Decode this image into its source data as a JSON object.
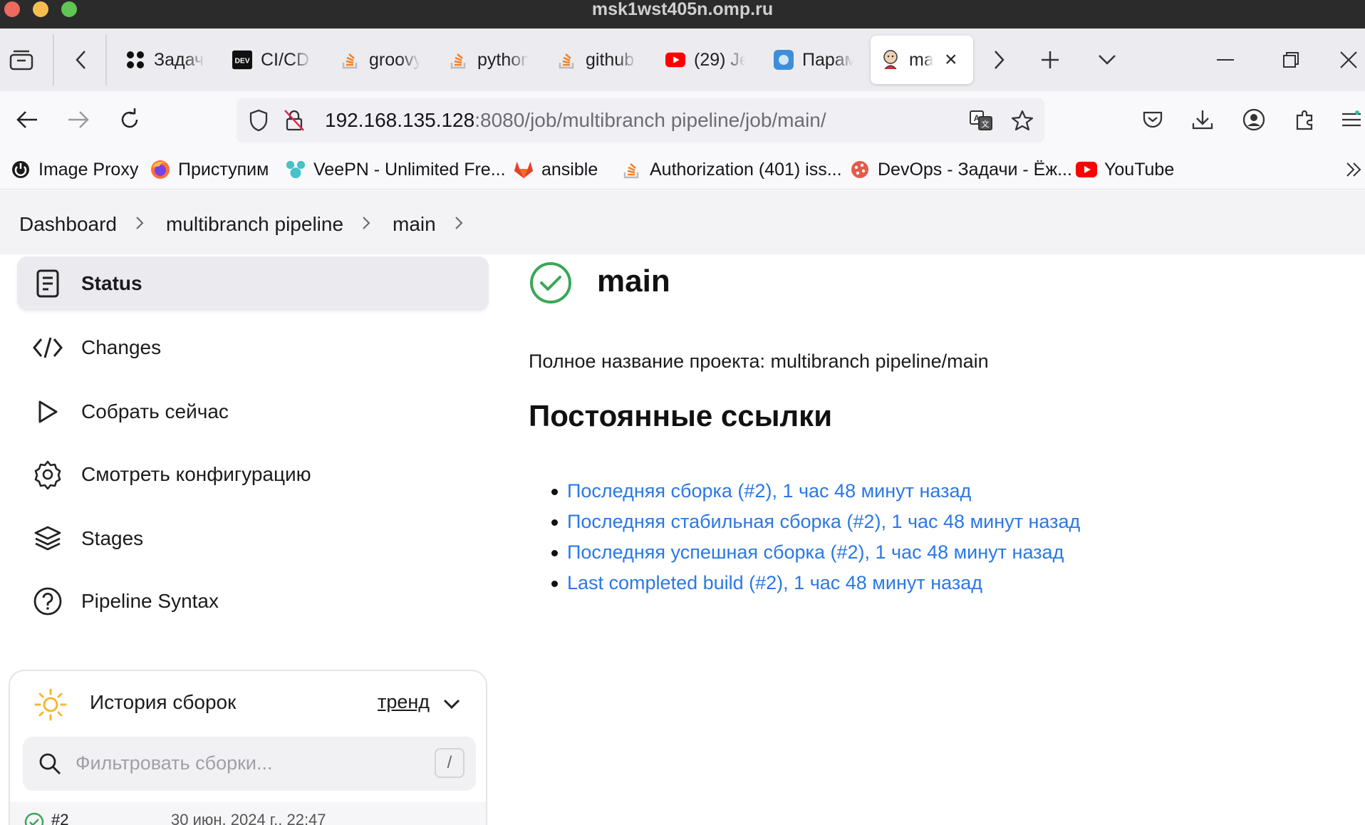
{
  "window": {
    "title": "msk1wst405n.omp.ru"
  },
  "tabs": [
    {
      "label": "Задачи",
      "icon": "puzzle-icon"
    },
    {
      "label": "CI/CD",
      "icon": "dev-icon"
    },
    {
      "label": "groovy",
      "icon": "stackoverflow-icon"
    },
    {
      "label": "python",
      "icon": "stackoverflow-icon"
    },
    {
      "label": "github",
      "icon": "stackoverflow-icon"
    },
    {
      "label": "(29) Je",
      "icon": "youtube-icon"
    },
    {
      "label": "Парам",
      "icon": "app-icon"
    },
    {
      "label": "main",
      "icon": "jenkins-icon"
    }
  ],
  "urlbar": {
    "host": "192.168.135.128",
    "path": ":8080/job/multibranch pipeline/job/main/"
  },
  "bookmarks": [
    {
      "label": "Image Proxy",
      "icon": "power-icon"
    },
    {
      "label": "Приступим",
      "icon": "firefox-icon"
    },
    {
      "label": "VeePN - Unlimited Fre...",
      "icon": "veepn-icon"
    },
    {
      "label": "ansible",
      "icon": "gitlab-icon"
    },
    {
      "label": "Authorization (401) iss...",
      "icon": "stackoverflow-icon"
    },
    {
      "label": "DevOps - Задачи - Ёж...",
      "icon": "devops-icon"
    },
    {
      "label": "YouTube",
      "icon": "youtube-icon"
    }
  ],
  "breadcrumb": [
    "Dashboard",
    "multibranch pipeline",
    "main"
  ],
  "side_nav": [
    {
      "label": "Status",
      "icon": "document-icon"
    },
    {
      "label": "Changes",
      "icon": "code-icon"
    },
    {
      "label": "Собрать сейчас",
      "icon": "play-icon"
    },
    {
      "label": "Смотреть конфигурацию",
      "icon": "gear-icon"
    },
    {
      "label": "Stages",
      "icon": "layers-icon"
    },
    {
      "label": "Pipeline Syntax",
      "icon": "help-icon"
    }
  ],
  "history": {
    "title": "История сборок",
    "trend": "тренд",
    "filter_placeholder": "Фильтровать сборки...",
    "shortcut": "/",
    "builds": [
      {
        "number": "#2",
        "date": "30 июн. 2024 г., 22:47"
      }
    ]
  },
  "main": {
    "title": "main",
    "full_name": "Полное название проекта: multibranch pipeline/main",
    "permalinks_heading": "Постоянные ссылки",
    "permalinks": [
      "Последняя сборка (#2), 1 час 48 минут назад",
      "Последняя стабильная сборка (#2), 1 час 48 минут назад",
      "Последняя успешная сборка (#2), 1 час 48 минут назад",
      "Last completed build (#2), 1 час 48 минут назад"
    ]
  },
  "colors": {
    "success": "#3aa757",
    "link": "#2b78e4",
    "sun": "#f5b82e"
  }
}
